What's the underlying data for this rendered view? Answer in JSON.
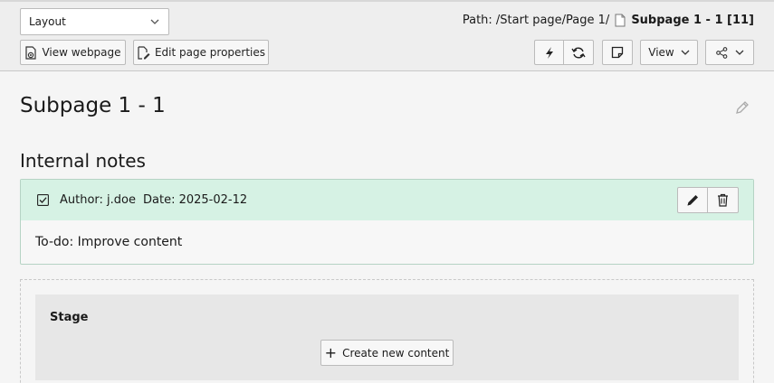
{
  "docheader": {
    "module_select": {
      "value": "Layout"
    },
    "path": {
      "label": "Path: /Start page/Page 1/",
      "current": "Subpage 1 - 1 [11]"
    },
    "buttons": {
      "view_webpage": "View webpage",
      "edit_page_properties": "Edit page properties",
      "view_dropdown": "View"
    }
  },
  "page": {
    "title": "Subpage 1 - 1"
  },
  "notes": {
    "heading": "Internal notes",
    "items": [
      {
        "author": "Author: j.doe",
        "date": "Date: 2025-02-12",
        "text": "To-do: Improve content"
      }
    ]
  },
  "content": {
    "column_title": "Stage",
    "create_label": "Create new content"
  },
  "colors": {
    "header_bg": "#eeeeee",
    "note_header_bg": "#d6f2e4",
    "stage_bg": "#e7e7e7"
  }
}
